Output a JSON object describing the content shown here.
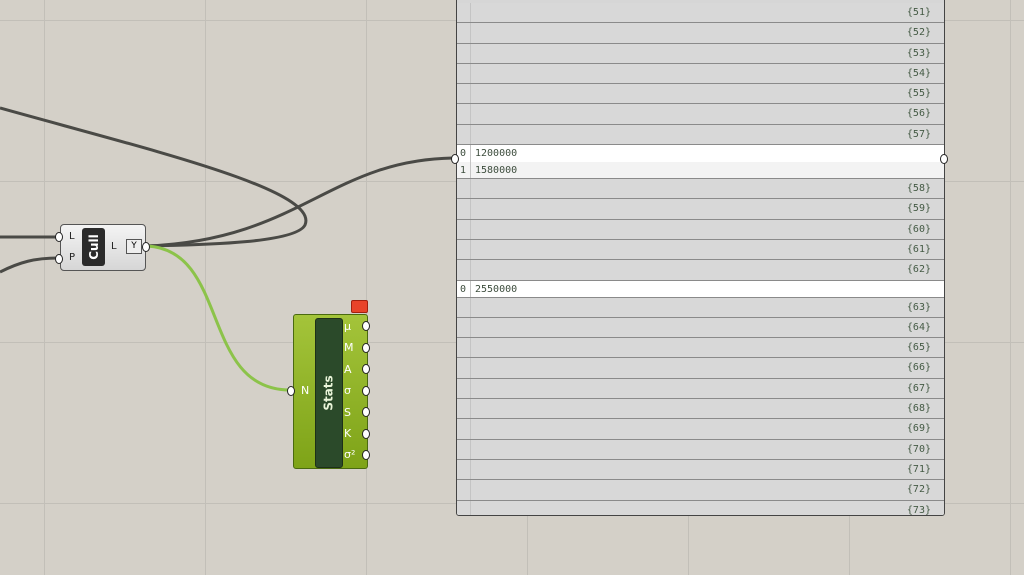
{
  "cull": {
    "title": "Cull",
    "inputs": [
      "L",
      "P"
    ],
    "output": "L",
    "flag": "Y"
  },
  "stats": {
    "title": "Stats",
    "input": "N",
    "outputs": [
      "μ",
      "M",
      "A",
      "σ",
      "S",
      "K",
      "σ²"
    ]
  },
  "panel": {
    "rows": [
      {
        "type": "path",
        "label": "{51}"
      },
      {
        "type": "path",
        "label": "{52}"
      },
      {
        "type": "path",
        "label": "{53}"
      },
      {
        "type": "path",
        "label": "{54}"
      },
      {
        "type": "path",
        "label": "{55}"
      },
      {
        "type": "path",
        "label": "{56}"
      },
      {
        "type": "path",
        "label": "{57}"
      },
      {
        "type": "item",
        "index": "0",
        "value": "1200000"
      },
      {
        "type": "item",
        "index": "1",
        "value": "1580000",
        "last": true
      },
      {
        "type": "path",
        "label": "{58}"
      },
      {
        "type": "path",
        "label": "{59}"
      },
      {
        "type": "path",
        "label": "{60}"
      },
      {
        "type": "path",
        "label": "{61}"
      },
      {
        "type": "path",
        "label": "{62}"
      },
      {
        "type": "item",
        "index": "0",
        "value": "2550000",
        "last": true
      },
      {
        "type": "path",
        "label": "{63}"
      },
      {
        "type": "path",
        "label": "{64}"
      },
      {
        "type": "path",
        "label": "{65}"
      },
      {
        "type": "path",
        "label": "{66}"
      },
      {
        "type": "path",
        "label": "{67}"
      },
      {
        "type": "path",
        "label": "{68}"
      },
      {
        "type": "path",
        "label": "{69}"
      },
      {
        "type": "path",
        "label": "{70}"
      },
      {
        "type": "path",
        "label": "{71}"
      },
      {
        "type": "path",
        "label": "{72}"
      },
      {
        "type": "path",
        "label": "{73}"
      }
    ]
  }
}
